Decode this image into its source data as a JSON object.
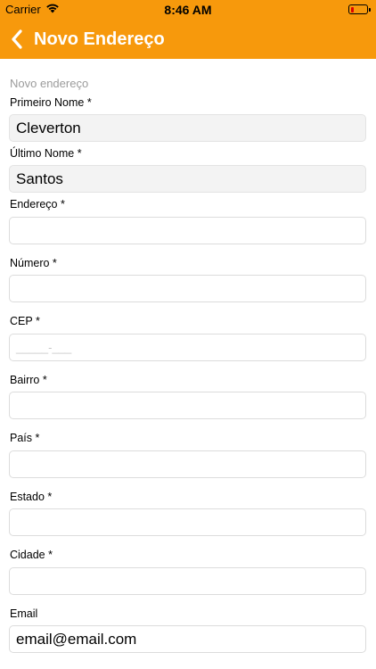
{
  "status_bar": {
    "carrier": "Carrier",
    "time": "8:46 AM",
    "battery_level": 0.2
  },
  "nav": {
    "title": "Novo Endereço"
  },
  "form": {
    "section_title": "Novo endereço",
    "first_name": {
      "label": "Primeiro Nome *",
      "value": "Cleverton"
    },
    "last_name": {
      "label": "Último Nome *",
      "value": "Santos"
    },
    "address": {
      "label": "Endereço *",
      "value": ""
    },
    "number": {
      "label": "Número *",
      "value": ""
    },
    "cep": {
      "label": "CEP *",
      "placeholder": "_____-___"
    },
    "neighborhood": {
      "label": "Bairro *",
      "value": ""
    },
    "country": {
      "label": "País *",
      "value": ""
    },
    "state": {
      "label": "Estado *",
      "value": ""
    },
    "city": {
      "label": "Cidade *",
      "value": ""
    },
    "email": {
      "label": "Email",
      "value": "email@email.com"
    }
  },
  "colors": {
    "brand": "#f7990c"
  },
  "icons": {
    "back": "chevron-left-icon",
    "wifi": "wifi-icon",
    "battery": "battery-icon"
  }
}
